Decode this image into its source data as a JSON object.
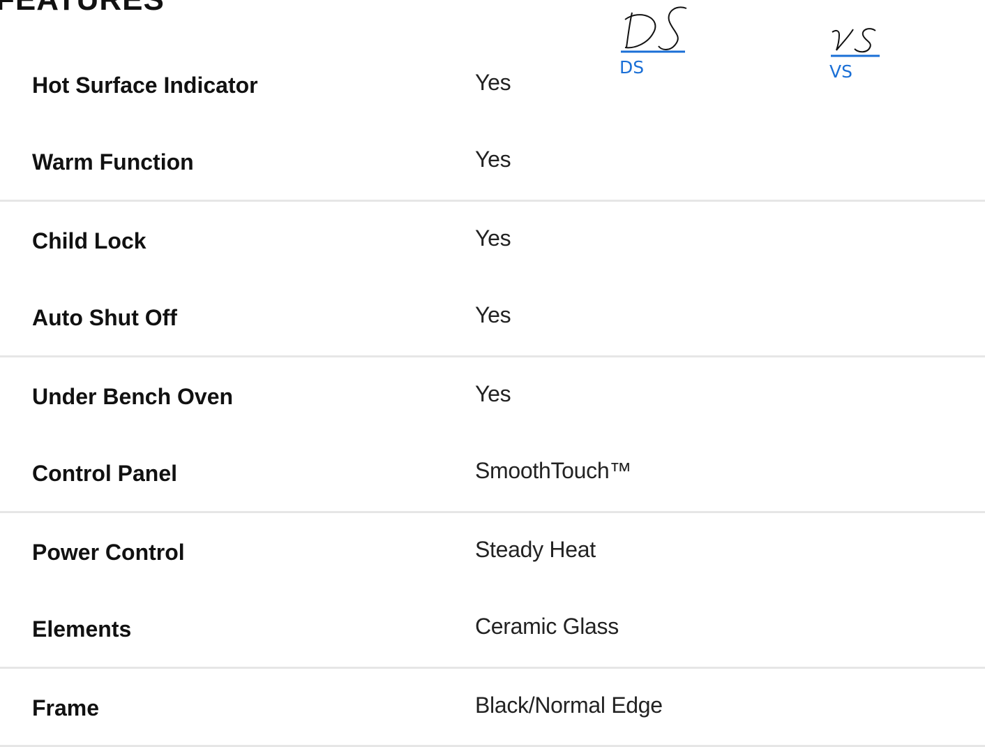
{
  "section": {
    "title": "FEATURES"
  },
  "rows": [
    {
      "label": "Hot Surface Indicator",
      "value": "Yes"
    },
    {
      "label": "Warm Function",
      "value": "Yes"
    },
    {
      "label": "Child Lock",
      "value": "Yes"
    },
    {
      "label": "Auto Shut Off",
      "value": "Yes"
    },
    {
      "label": "Under Bench Oven",
      "value": "Yes"
    },
    {
      "label": "Control Panel",
      "value": "SmoothTouch™"
    },
    {
      "label": "Power Control",
      "value": "Steady Heat"
    },
    {
      "label": "Elements",
      "value": "Ceramic Glass"
    },
    {
      "label": "Frame",
      "value": "Black/Normal Edge"
    }
  ],
  "annotations": [
    {
      "initials": "DS",
      "label": "DS",
      "color": "#1a6fd6"
    },
    {
      "initials": "VS",
      "label": "VS",
      "color": "#1a6fd6"
    }
  ],
  "colors": {
    "divider": "#e6e6e6",
    "annotation": "#1a6fd6",
    "text": "#111111"
  }
}
